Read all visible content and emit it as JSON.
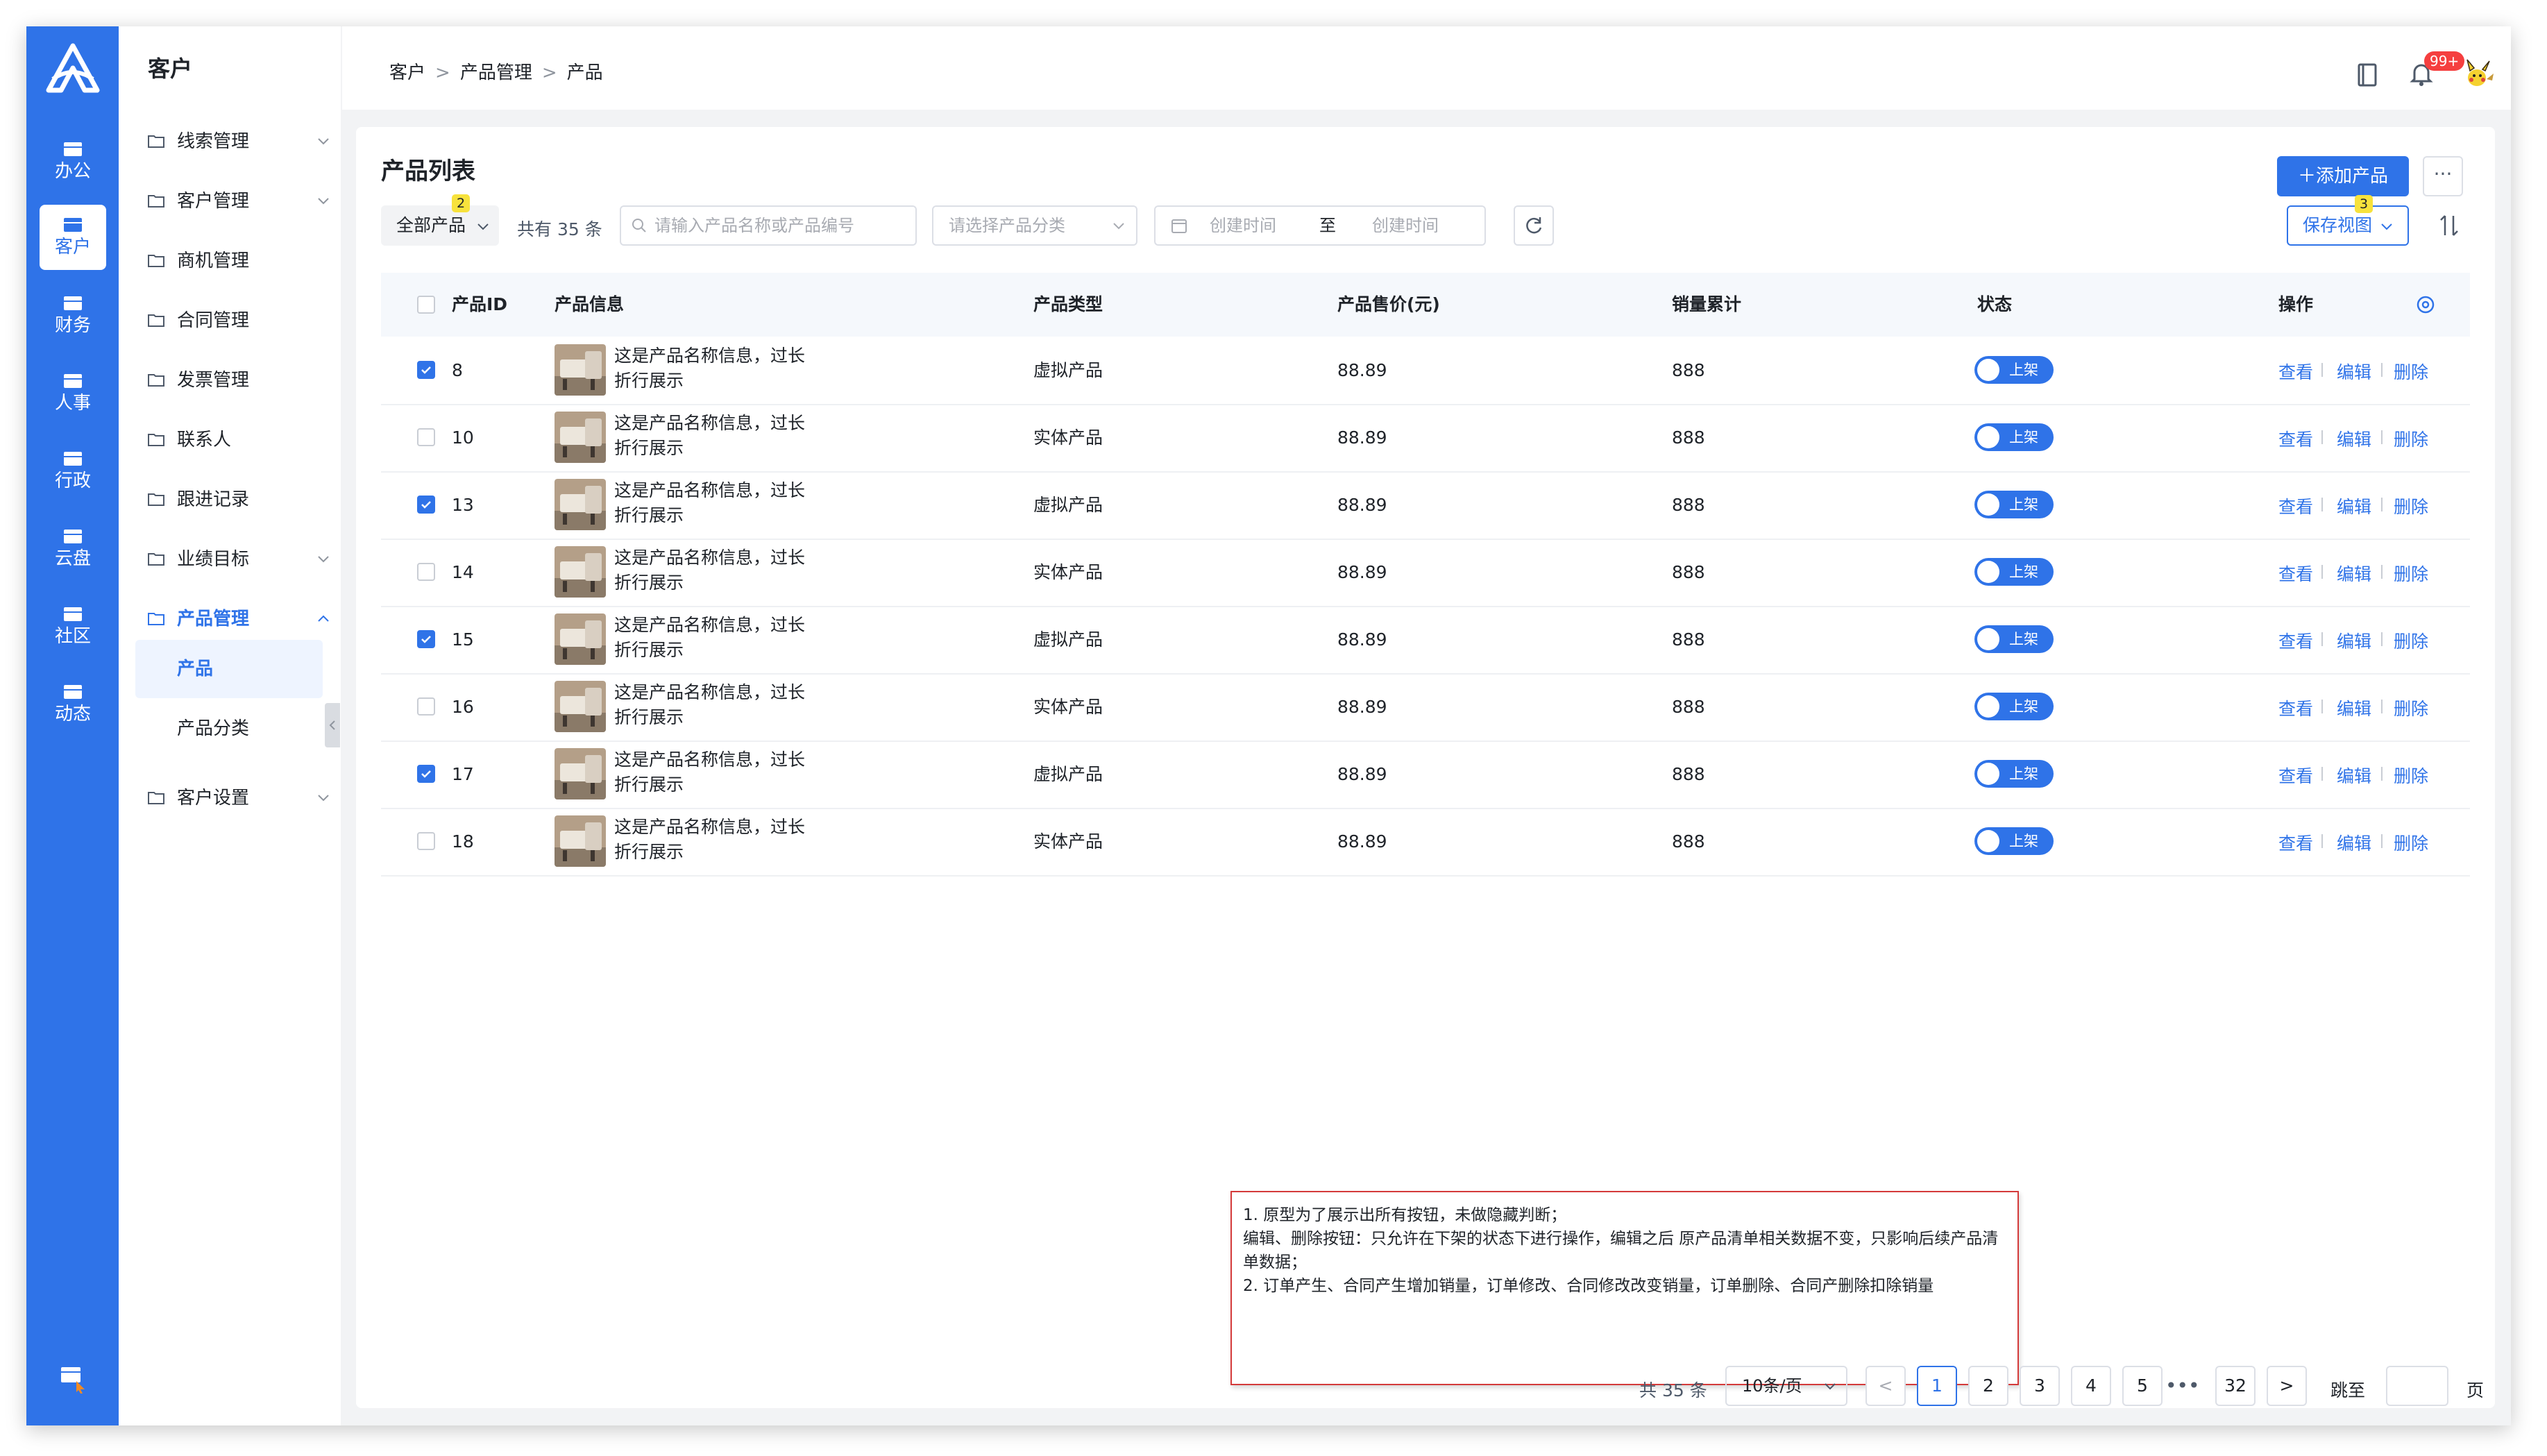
{
  "rail": {
    "items": [
      {
        "label": "办公"
      },
      {
        "label": "客户"
      },
      {
        "label": "财务"
      },
      {
        "label": "人事"
      },
      {
        "label": "行政"
      },
      {
        "label": "云盘"
      },
      {
        "label": "社区"
      },
      {
        "label": "动态"
      }
    ],
    "active_index": 1
  },
  "submenu": {
    "title": "客户",
    "items": [
      {
        "label": "线索管理"
      },
      {
        "label": "客户管理"
      },
      {
        "label": "商机管理"
      },
      {
        "label": "合同管理"
      },
      {
        "label": "发票管理"
      },
      {
        "label": "联系人"
      },
      {
        "label": "跟进记录"
      },
      {
        "label": "业绩目标"
      },
      {
        "label": "产品管理"
      },
      {
        "label": "客户设置"
      }
    ],
    "children": [
      {
        "label": "产品"
      },
      {
        "label": "产品分类"
      }
    ]
  },
  "header": {
    "breadcrumb": [
      "客户",
      "产品管理",
      "产品"
    ],
    "separator": ">",
    "notification_badge": "99+"
  },
  "toolbar": {
    "page_title": "产品列表",
    "add_button": "添加产品",
    "more_button": "···",
    "tab_all": "全部产品",
    "tab_all_badge": "2",
    "total_text": "共有 35 条",
    "search_placeholder": "请输入产品名称或产品编号",
    "category_placeholder": "请选择产品分类",
    "date_start": "创建时间",
    "date_to": "至",
    "date_end": "创建时间",
    "save_view": "保存视图",
    "save_view_badge": "3"
  },
  "table": {
    "columns": [
      "产品ID",
      "产品信息",
      "产品类型",
      "产品售价(元)",
      "销量累计",
      "状态",
      "操作"
    ],
    "rows": [
      {
        "id": "8",
        "info_line1": "这是产品名称信息，过长",
        "info_line2": "折行展示",
        "type": "虚拟产品",
        "price": "88.89",
        "sales": "888",
        "status": "上架",
        "checked": true
      },
      {
        "id": "10",
        "info_line1": "这是产品名称信息，过长",
        "info_line2": "折行展示",
        "type": "实体产品",
        "price": "88.89",
        "sales": "888",
        "status": "上架",
        "checked": false
      },
      {
        "id": "13",
        "info_line1": "这是产品名称信息，过长",
        "info_line2": "折行展示",
        "type": "虚拟产品",
        "price": "88.89",
        "sales": "888",
        "status": "上架",
        "checked": true
      },
      {
        "id": "14",
        "info_line1": "这是产品名称信息，过长",
        "info_line2": "折行展示",
        "type": "实体产品",
        "price": "88.89",
        "sales": "888",
        "status": "上架",
        "checked": false
      },
      {
        "id": "15",
        "info_line1": "这是产品名称信息，过长",
        "info_line2": "折行展示",
        "type": "虚拟产品",
        "price": "88.89",
        "sales": "888",
        "status": "上架",
        "checked": true
      },
      {
        "id": "16",
        "info_line1": "这是产品名称信息，过长",
        "info_line2": "折行展示",
        "type": "实体产品",
        "price": "88.89",
        "sales": "888",
        "status": "上架",
        "checked": false
      },
      {
        "id": "17",
        "info_line1": "这是产品名称信息，过长",
        "info_line2": "折行展示",
        "type": "虚拟产品",
        "price": "88.89",
        "sales": "888",
        "status": "上架",
        "checked": true
      },
      {
        "id": "18",
        "info_line1": "这是产品名称信息，过长",
        "info_line2": "折行展示",
        "type": "实体产品",
        "price": "88.89",
        "sales": "888",
        "status": "上架",
        "checked": false
      }
    ],
    "actions": [
      "查看",
      "编辑",
      "删除"
    ]
  },
  "note": {
    "lines": [
      "1. 原型为了展示出所有按钮，未做隐藏判断；",
      "编辑、删除按钮：只允许在下架的状态下进行操作，编辑之后 原产品清单相关数据不变，只影响后续产品清单数据；",
      "2. 订单产生、合同产生增加销量，订单修改、合同修改改变销量，订单删除、合同产删除扣除销量"
    ]
  },
  "pagination": {
    "total": "共 35 条",
    "page_size": "10条/页",
    "prev": "<",
    "next": ">",
    "pages": [
      "1",
      "2",
      "3",
      "4",
      "5"
    ],
    "ellipsis": "•••",
    "last": "32",
    "jump_label": "跳至",
    "page_label": "页"
  },
  "colors": {
    "primary": "#2f73e8",
    "note_border": "#d43a3a",
    "badge_red": "#f53f3f",
    "badge_yellow": "#f7e23c"
  }
}
